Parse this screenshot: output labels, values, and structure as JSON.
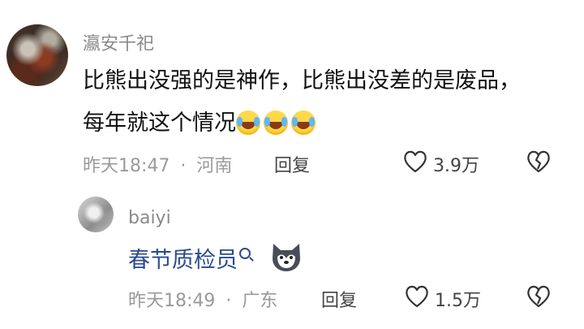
{
  "comments": [
    {
      "username": "瀛安千祀",
      "text_line1": "比熊出没强的是神作，比熊出没差的是废品，",
      "text_line2": "每年就这个情况",
      "emoji_count": 3,
      "emoji_name": "laughing-crying-emoji",
      "time": "昨天18:47",
      "separator": "·",
      "location": "河南",
      "reply_label": "回复",
      "likes": "3.9万"
    }
  ],
  "reply": {
    "username": "baiyi",
    "text": "春节质检员",
    "time": "昨天18:49",
    "separator": "·",
    "location": "广东",
    "reply_label": "回复",
    "likes": "1.5万"
  },
  "icons": {
    "like": "heart-outline-icon",
    "dislike": "broken-heart-icon",
    "search": "search-icon",
    "husky": "husky-emoji"
  }
}
